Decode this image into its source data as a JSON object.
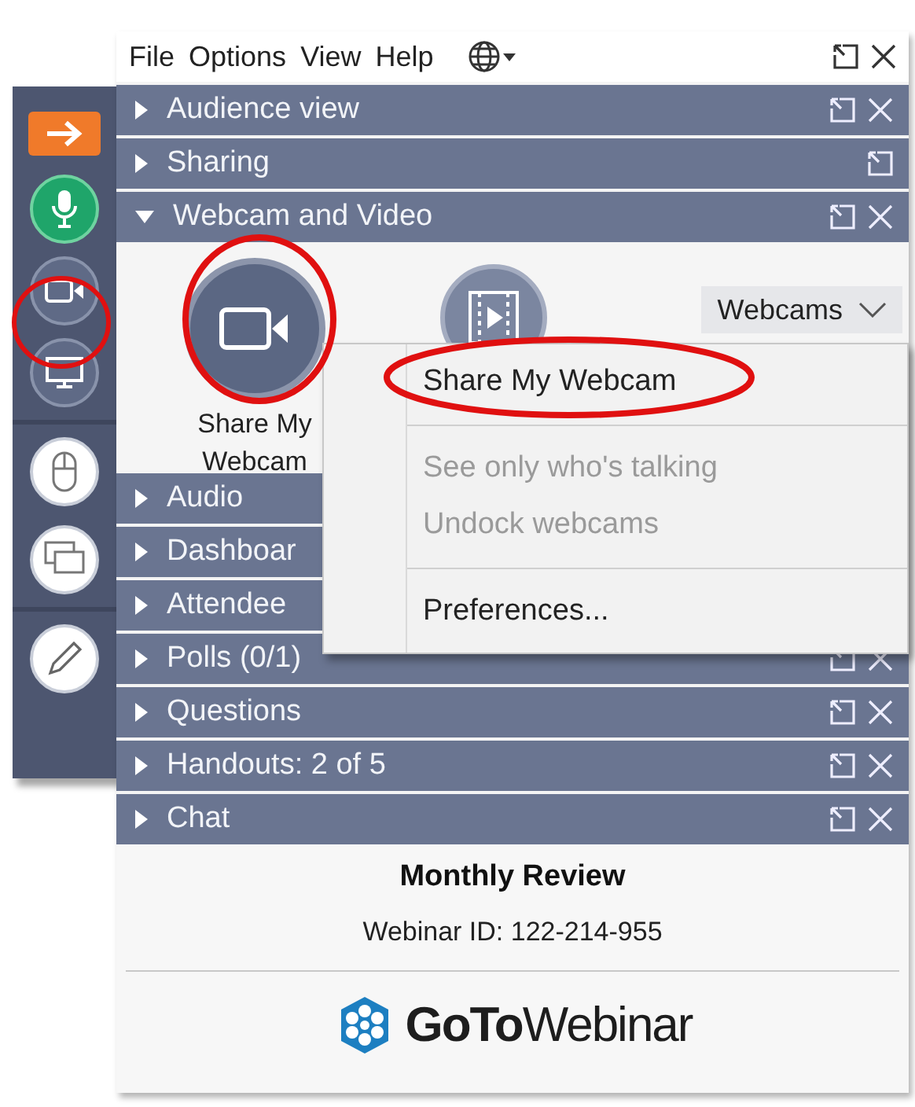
{
  "menu_bar": {
    "items": [
      "File",
      "Options",
      "View",
      "Help"
    ],
    "popout": true,
    "close": true
  },
  "sidebar": {
    "microphone_on": true
  },
  "sections": [
    {
      "label": "Audience view",
      "expanded": false,
      "popout": true,
      "close": true
    },
    {
      "label": "Sharing",
      "expanded": false,
      "popout": true,
      "close": false
    },
    {
      "label": "Webcam and Video",
      "expanded": true,
      "popout": true,
      "close": true,
      "panel": {
        "share_label": "Share My Webcam",
        "dropdown_label": "Webcams"
      }
    },
    {
      "label": "Audio",
      "expanded": false,
      "popout": false,
      "close": false
    },
    {
      "label": "Dashboar",
      "expanded": false,
      "popout": false,
      "close": false
    },
    {
      "label": "Attendee",
      "expanded": false,
      "popout": false,
      "close": false
    },
    {
      "label": "Polls (0/1)",
      "expanded": false,
      "popout": true,
      "close": true
    },
    {
      "label": "Questions",
      "expanded": false,
      "popout": true,
      "close": true
    },
    {
      "label": "Handouts: 2 of 5",
      "expanded": false,
      "popout": true,
      "close": true
    },
    {
      "label": "Chat",
      "expanded": false,
      "popout": true,
      "close": true
    }
  ],
  "context_menu": [
    {
      "kind": "item",
      "label": "Share My Webcam",
      "disabled": false
    },
    {
      "kind": "separator"
    },
    {
      "kind": "item",
      "label": "See only who's talking",
      "disabled": true
    },
    {
      "kind": "item",
      "label": "Undock webcams",
      "disabled": true
    },
    {
      "kind": "separator"
    },
    {
      "kind": "item",
      "label": "Preferences...",
      "disabled": false
    }
  ],
  "footer": {
    "title": "Monthly Review",
    "webinar_id": "Webinar ID: 122-214-955",
    "logo_text": "**GoTo**Webinar"
  }
}
